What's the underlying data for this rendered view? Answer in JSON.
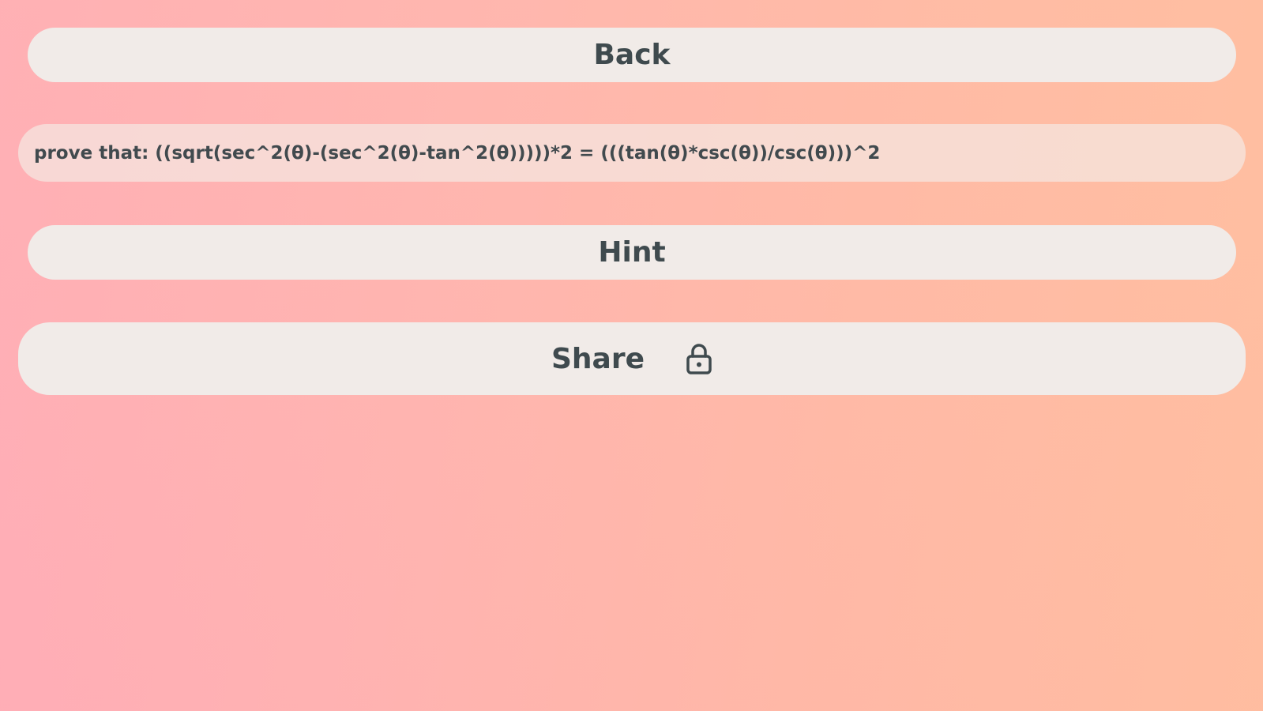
{
  "buttons": {
    "back_label": "Back",
    "hint_label": "Hint",
    "share_label": "Share",
    "share_icon": "lock-icon"
  },
  "problem": {
    "text": "prove that: ((sqrt(sec^2(θ)-(sec^2(θ)-tan^2(θ)))))*2 = (((tan(θ)*csc(θ))/csc(θ)))^2"
  },
  "colors": {
    "button_bg": "#f1ebe8",
    "text": "#3f4a4e",
    "gradient_left": "#ffacb8",
    "gradient_right": "#ffc09c"
  }
}
